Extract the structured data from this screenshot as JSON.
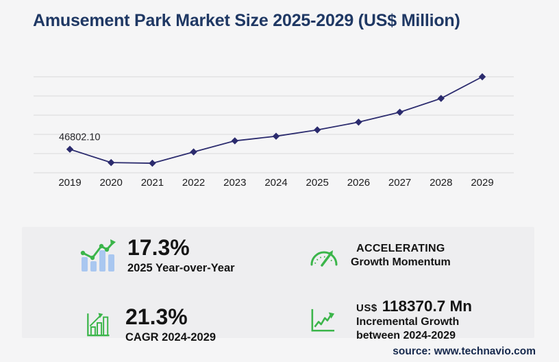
{
  "header": {
    "title": "Amusement Park Market Size 2025-2029 (US$ Million)"
  },
  "chart_data": {
    "type": "line",
    "title": "Amusement Park Market Size 2025-2029 (US$ Million)",
    "categories": [
      "2019",
      "2020",
      "2021",
      "2022",
      "2023",
      "2024",
      "2025",
      "2026",
      "2027",
      "2028",
      "2029"
    ],
    "series": [
      {
        "name": "Market size (US$ million)",
        "values": [
          46802.1,
          20300,
          19000,
          41500,
          63600,
          72790,
          85380,
          100800,
          120650,
          148100,
          191160
        ]
      }
    ],
    "data_label": {
      "category": "2019",
      "text": "46802.10"
    },
    "xlabel": "",
    "ylabel": "",
    "ylim": [
      0,
      215000
    ],
    "grid": "horizontal",
    "gridline_count": 6,
    "y_axis_labels_visible": false,
    "marker": "diamond",
    "line_color": "#2b2b6e",
    "legend": "none"
  },
  "stats": {
    "yoy": {
      "icon": "bar-chart-trend-icon",
      "value": "17.3%",
      "label": "2025 Year-over-Year"
    },
    "momentum": {
      "icon": "speedometer-icon",
      "line1": "ACCELERATING",
      "line2": "Growth Momentum"
    },
    "cagr": {
      "icon": "growth-bars-arrow-icon",
      "value": "21.3%",
      "label": "CAGR 2024-2029"
    },
    "incremental": {
      "icon": "trend-axis-arrow-icon",
      "currency": "US$",
      "value": "118370.7 Mn",
      "line1": "Incremental Growth",
      "line2": "between 2024-2029"
    }
  },
  "footer": {
    "source": "source: www.technavio.com"
  },
  "colors": {
    "title": "#1f3864",
    "line": "#2b2b6e",
    "gridline": "#d9d9da",
    "green": "#3bb54a",
    "light_blue": "#a9c7f0",
    "page_bg": "#f5f5f6",
    "panel_bg": "#eeeef0",
    "text": "#141414",
    "source_text": "#16294d"
  }
}
